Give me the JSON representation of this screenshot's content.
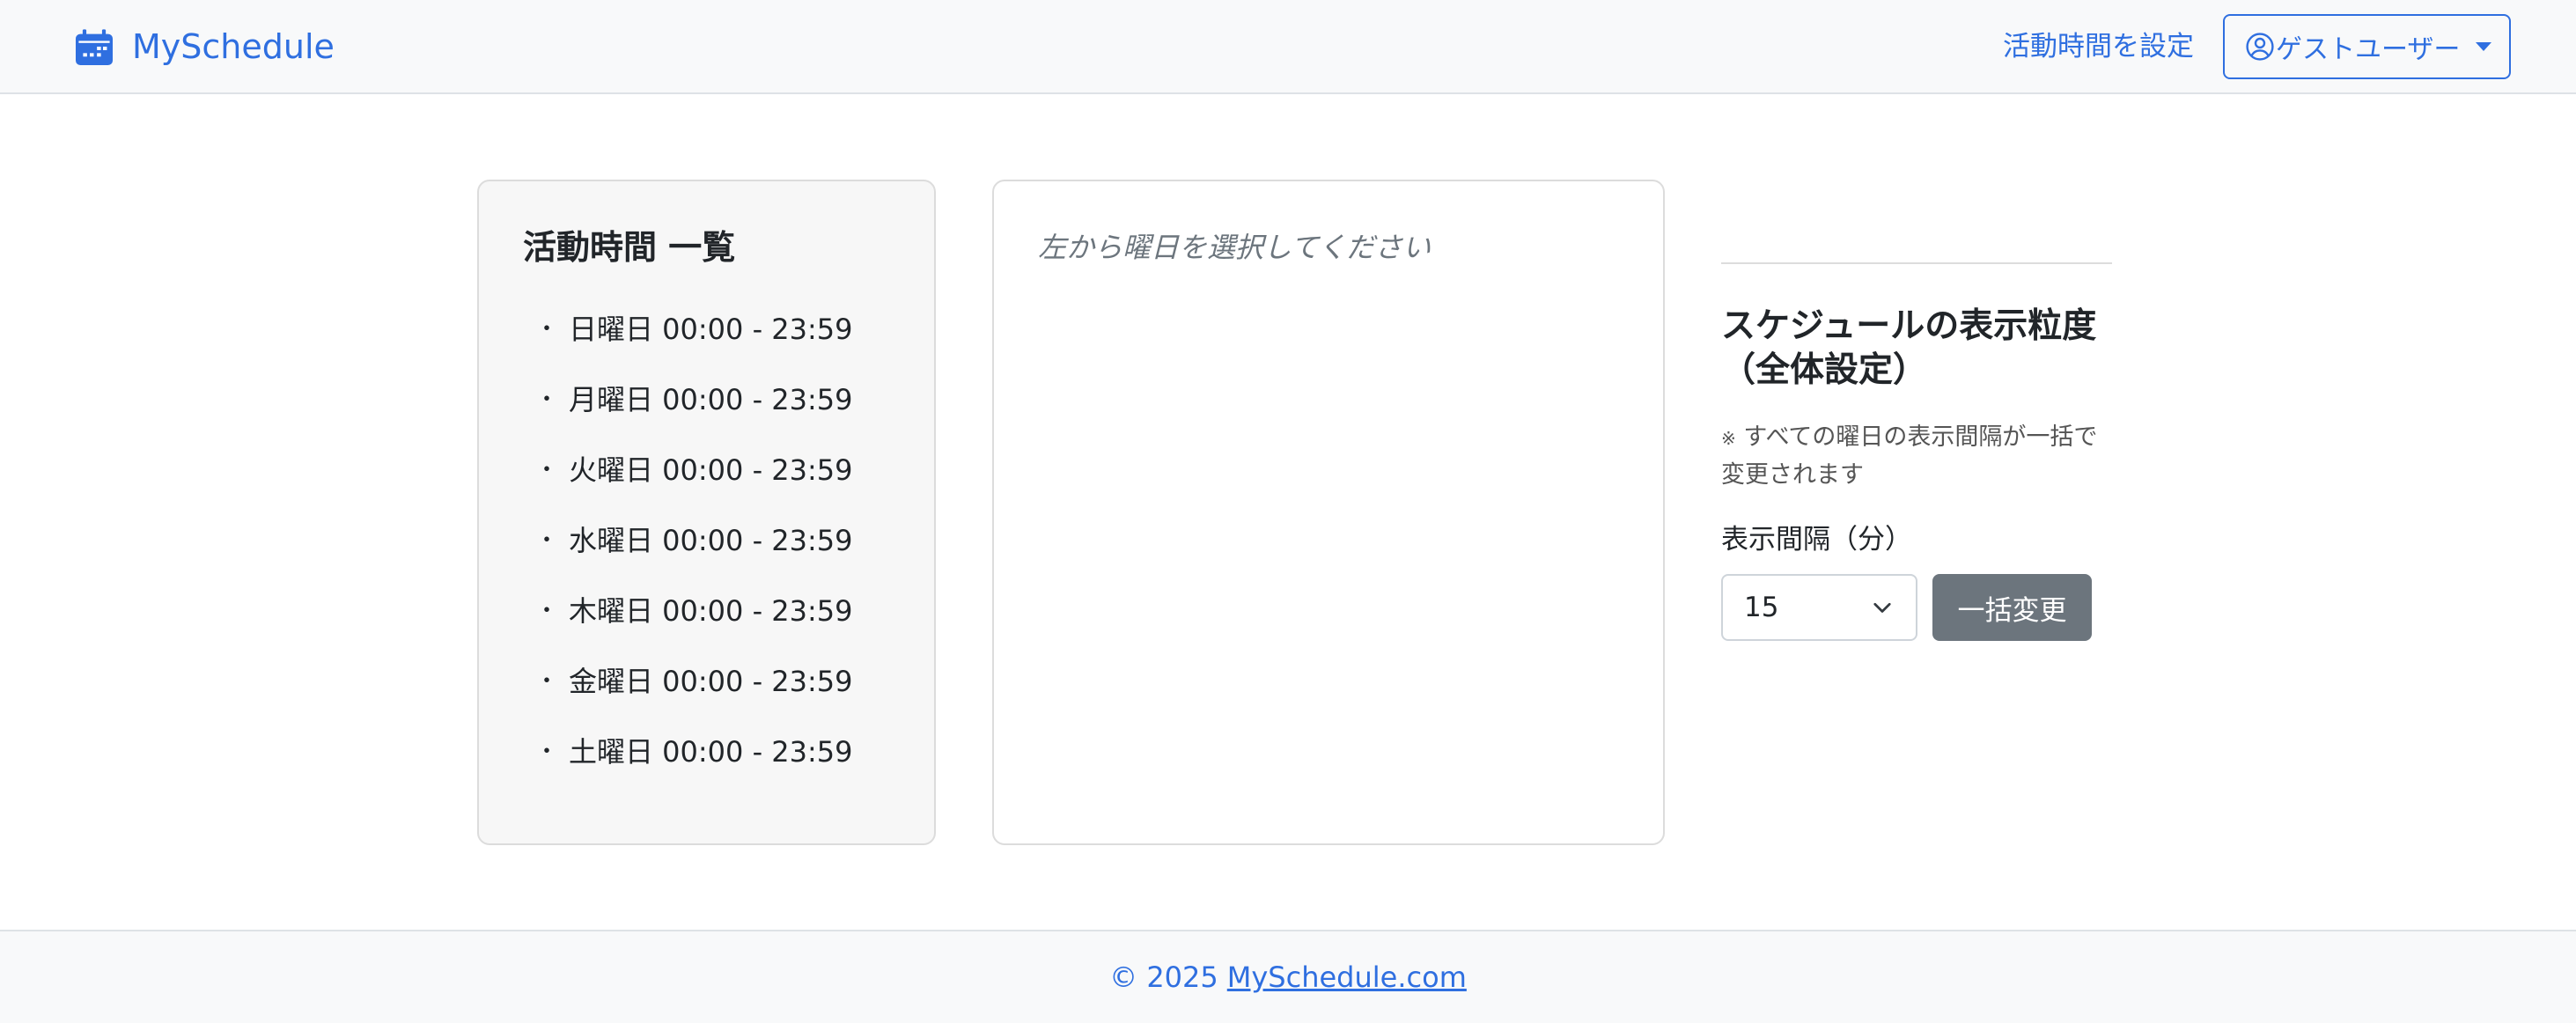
{
  "navbar": {
    "brand": "MySchedule",
    "brand_icon": "calendar-icon",
    "activity_link": "活動時間を設定",
    "user_menu": "ゲストユーザー",
    "user_icon": "person-circle-icon",
    "accent_color": "#2f6fe0"
  },
  "activity_list": {
    "title": "活動時間 一覧",
    "bullet": "・",
    "items": [
      "日曜日 00:00 - 23:59",
      "月曜日 00:00 - 23:59",
      "火曜日 00:00 - 23:59",
      "水曜日 00:00 - 23:59",
      "木曜日 00:00 - 23:59",
      "金曜日 00:00 - 23:59",
      "土曜日 00:00 - 23:59"
    ]
  },
  "detail": {
    "hint": "左から曜日を選択してください"
  },
  "settings": {
    "title": "スケジュールの表示粒度（全体設定）",
    "note_mark": "※",
    "note": "すべての曜日の表示間隔が一括で変更されます",
    "interval_label": "表示間隔（分）",
    "interval_value": "15",
    "apply_button": "一括変更"
  },
  "footer": {
    "copyright": "© 2025",
    "link": "MySchedule.com"
  }
}
